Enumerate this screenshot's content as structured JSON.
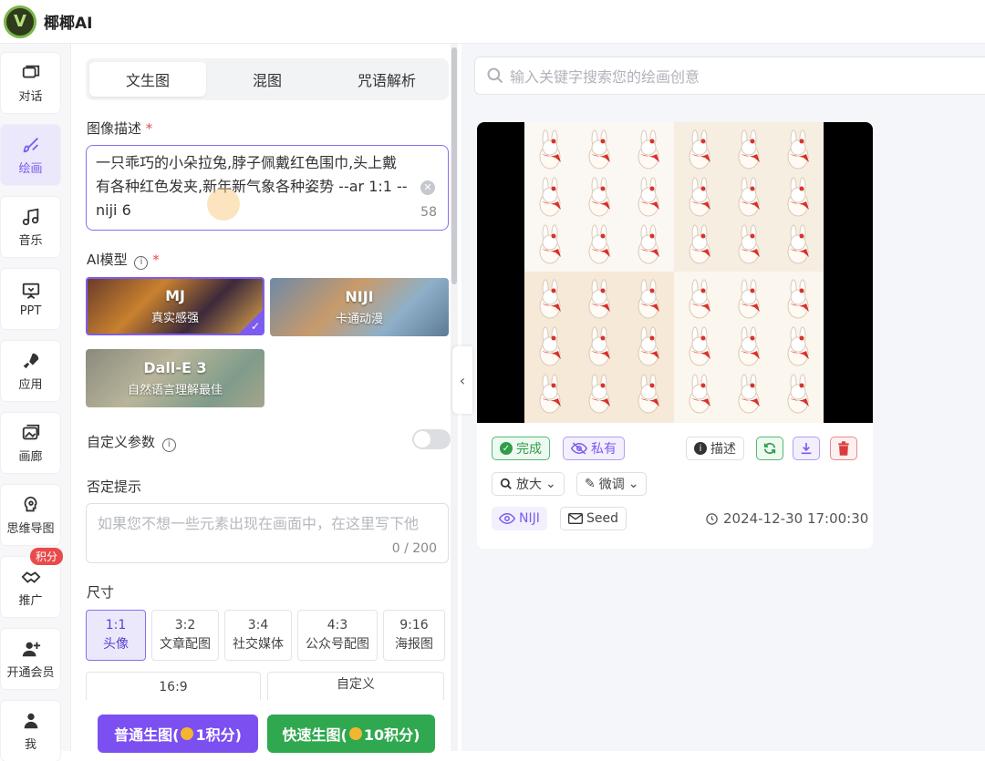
{
  "app": {
    "title": "椰椰AI",
    "logo_letter": "V"
  },
  "nav": [
    {
      "label": "对话",
      "icon": "chat-icon"
    },
    {
      "label": "绘画",
      "icon": "brush-icon",
      "active": true
    },
    {
      "label": "音乐",
      "icon": "music-icon"
    },
    {
      "label": "PPT",
      "icon": "presentation-icon"
    },
    {
      "label": "应用",
      "icon": "rocket-icon"
    },
    {
      "label": "画廊",
      "icon": "gallery-icon"
    },
    {
      "label": "思维导图",
      "icon": "mindmap-icon"
    },
    {
      "label": "推广",
      "icon": "handshake-icon",
      "badge": "积分"
    },
    {
      "label": "开通会员",
      "icon": "user-plus-icon"
    },
    {
      "label": "我",
      "icon": "user-icon"
    }
  ],
  "tabs": [
    "文生图",
    "混图",
    "咒语解析"
  ],
  "description": {
    "label": "图像描述",
    "required_mark": "*",
    "value": "一只乖巧的小朵拉兔,脖子佩戴红色围巾,头上戴有各种红色发夹,新年新气象各种姿势 --ar 1:1 --niji 6",
    "count": "58"
  },
  "model": {
    "label": "AI模型",
    "required_mark": "*",
    "info_icon": "info-icon",
    "cards": [
      {
        "name": "MJ",
        "sub": "真实感强",
        "selected": true
      },
      {
        "name": "NIJI",
        "sub": "卡通动漫"
      },
      {
        "name": "Dall-E 3",
        "sub": "自然语言理解最佳"
      }
    ]
  },
  "custom_params": {
    "label": "自定义参数"
  },
  "negative": {
    "label": "否定提示",
    "placeholder": "如果您不想一些元素出现在画面中，在这里写下他",
    "count": "0 / 200"
  },
  "size": {
    "label": "尺寸",
    "options": [
      {
        "ratio": "1:1",
        "name": "头像",
        "active": true
      },
      {
        "ratio": "3:2",
        "name": "文章配图"
      },
      {
        "ratio": "3:4",
        "name": "社交媒体"
      },
      {
        "ratio": "4:3",
        "name": "公众号配图"
      },
      {
        "ratio": "9:16",
        "name": "海报图"
      },
      {
        "ratio": "16:9",
        "name": ""
      },
      {
        "ratio": "",
        "name": "自定义"
      }
    ]
  },
  "buttons": {
    "normal": {
      "label_pre": "普通生图(",
      "label_post": "1积分)",
      "color": "#7c4ff0"
    },
    "fast": {
      "label_pre": "快速生图(",
      "label_post": "10积分)",
      "color": "#2fa84f"
    }
  },
  "search": {
    "placeholder": "输入关键字搜索您的绘画创意"
  },
  "result": {
    "status": "完成",
    "privacy": "私有",
    "describe": "描述",
    "upscale": "放大",
    "tweak": "微调",
    "model_tag": "NIJI",
    "seed": "Seed",
    "timestamp": "2024-12-30 17:00:30"
  }
}
